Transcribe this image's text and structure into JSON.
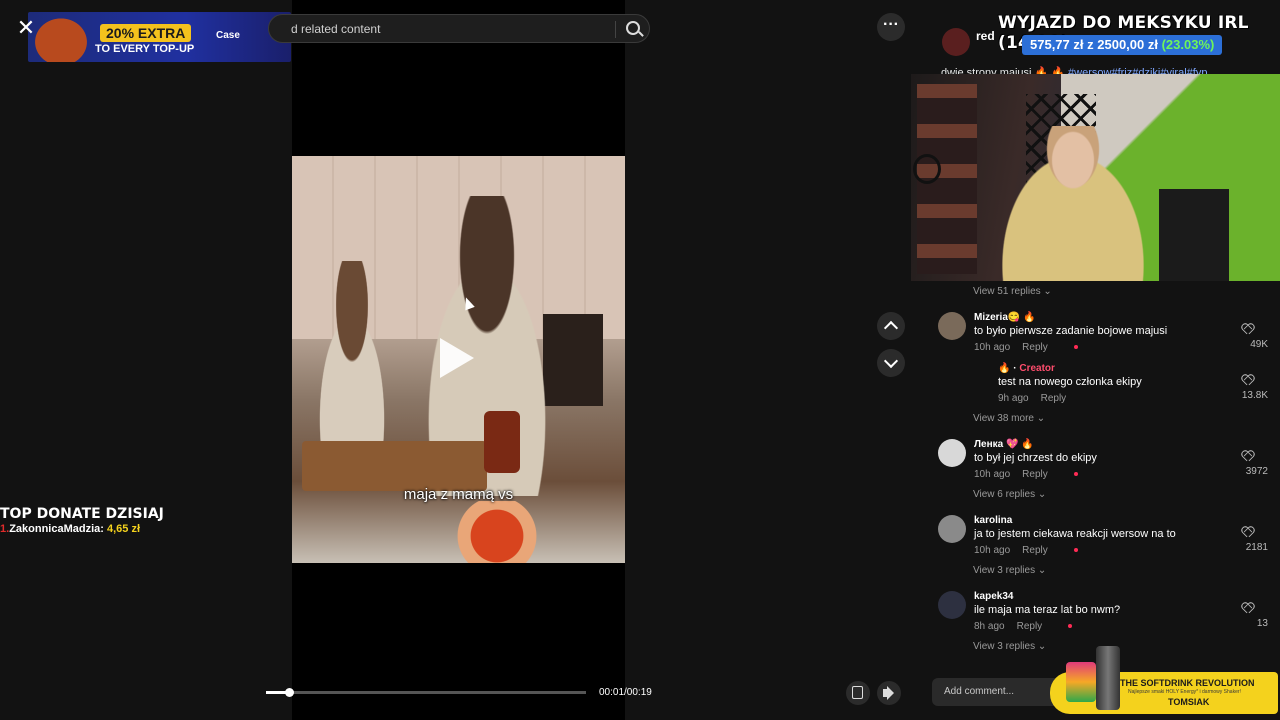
{
  "top_bar": {
    "close_icon": "close-icon",
    "search_placeholder": "d related content",
    "search_icon": "search-icon",
    "more_icon": "more-horizontal-icon"
  },
  "ad": {
    "extra": "20% EXTRA",
    "tagline": "TO EVERY TOP-UP",
    "brand": "Case"
  },
  "video": {
    "subtitle": "maja z mamą vs",
    "time": "00:01/00:19",
    "progress": 0.072
  },
  "donate": {
    "title": "TOP DONATE DZISIAJ",
    "rank": "1.",
    "name": "ZakonnicaMadzia:",
    "amount": "4,65 zł"
  },
  "stream": {
    "title": "WYJAZD DO MEKSYKU IRL (14-28)",
    "goal_current": "575,77 zł",
    "goal_mid": "z",
    "goal_target": "2500,00 zł",
    "goal_pct": "(23.03%)"
  },
  "post": {
    "author": "red",
    "description": "dwie strony majusi 🔥 🔥",
    "tags": "#wersow#friz#dziki#viral#fyp"
  },
  "comments": [
    {
      "user": "Mizeria😋 🔥",
      "text": "to było pierwsze zadanie bojowe majusi",
      "time": "10h ago",
      "reply": "Reply",
      "count": "49K"
    },
    {
      "user": "🔥 · ",
      "creator": "Creator",
      "text": "test na nowego członka ekipy",
      "time": "9h ago",
      "reply": "Reply",
      "count": "13.8K"
    },
    {
      "user": "Ленка 💖 🔥",
      "text": "to był jej chrzest do ekipy",
      "time": "10h ago",
      "reply": "Reply",
      "count": "3972"
    },
    {
      "user": "karolina",
      "text": "ja to jestem ciekawa reakcji wersow na to",
      "time": "10h ago",
      "reply": "Reply",
      "count": "2181"
    },
    {
      "user": "kapek34",
      "text": "ile maja ma teraz lat bo nwm?",
      "time": "8h ago",
      "reply": "Reply",
      "count": "13"
    }
  ],
  "view_replies": [
    "View 51 replies",
    "View 38 more",
    "View 6 replies",
    "View 3 replies",
    "View 3 replies"
  ],
  "add_comment_placeholder": "Add comment...",
  "softdrink": {
    "title": "THE SOFTDRINK REVOLUTION",
    "subtitle": "Najlepsze smaki HOLY Energy* i darmowy Shaker!",
    "name": "TOMSIAK"
  }
}
